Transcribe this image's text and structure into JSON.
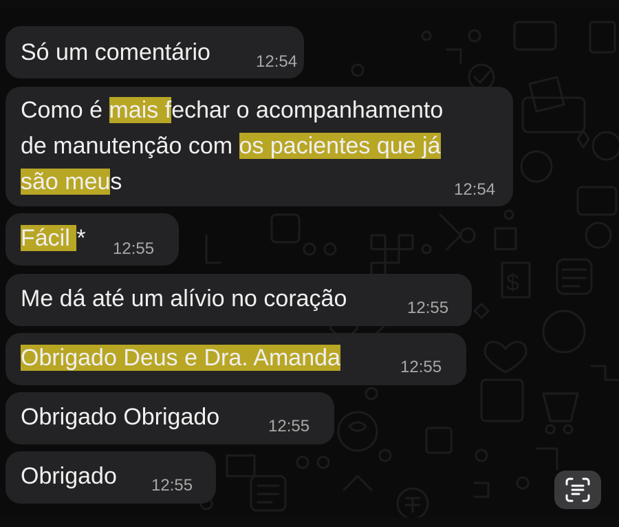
{
  "chat": {
    "messages": [
      {
        "text": "Só um comentário",
        "time": "12:54"
      },
      {
        "line1_a": "Como é ",
        "line1_hl": "mais f",
        "line1_b": "echar o acompanhamento",
        "line2_a": "de manutenção com ",
        "line2_hl": "os pacientes que já",
        "line3_hl": "são meu",
        "line3_b": "s",
        "time": "12:54"
      },
      {
        "hl": "Fácil ",
        "rest": "*",
        "time": "12:55"
      },
      {
        "text": "Me dá até um alívio no coração",
        "time": "12:55"
      },
      {
        "hl": "Obrigado Deus e Dra. Amanda",
        "time": "12:55"
      },
      {
        "text": "Obrigado Obrigado",
        "time": "12:55"
      },
      {
        "text": "Obrigado",
        "time": "12:55"
      }
    ]
  },
  "icons": {
    "scan_text": "scan-text-icon",
    "wallpaper": "doodle-pattern"
  },
  "colors": {
    "background": "#0b0b0b",
    "bubble": "#232325",
    "text": "#f0f0f0",
    "time": "#a8a8a8",
    "highlight": "#c8b52a"
  }
}
